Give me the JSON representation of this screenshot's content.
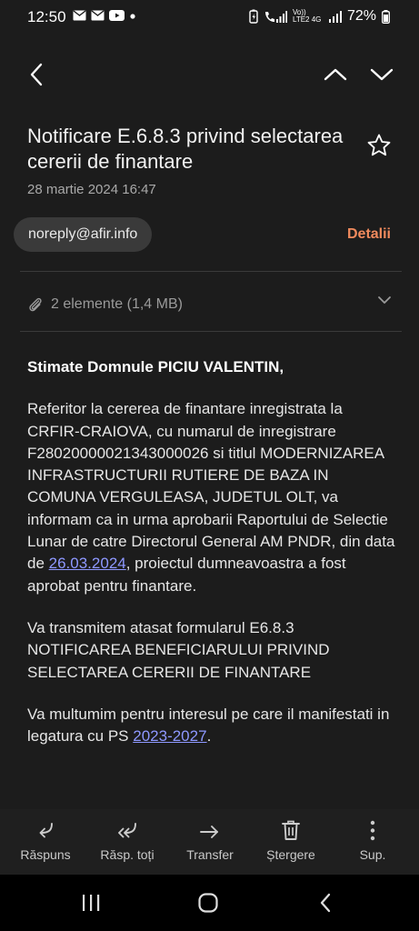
{
  "status_bar": {
    "time": "12:50",
    "battery": "72%",
    "network": "Vo)) LTE2 4G"
  },
  "email": {
    "subject": "Notificare E.6.8.3 privind selectarea cererii de finantare",
    "date": "28 martie 2024  16:47",
    "sender": "noreply@afir.info",
    "details_label": "Detalii",
    "attachments": "2 elemente (1,4 MB)",
    "greeting": "Stimate Domnule PICIU VALENTIN,",
    "para1_before": "Referitor la cererea de finantare inregistrata la CRFIR-CRAIOVA, cu numarul de inregistrare F28020000021343000026 si titlul MODERNIZAREA INFRASTRUCTURII RUTIERE DE BAZA IN COMUNA VERGULEASA, JUDETUL OLT, va informam ca in urma aprobarii Raportului de Selectie Lunar de catre Directorul General AM PNDR, din data de ",
    "para1_link": "26.03.2024",
    "para1_after": ", proiectul dumneavoastra a fost aprobat pentru finantare.",
    "para2": "Va transmitem atasat formularul E6.8.3 NOTIFICAREA BENEFICIARULUI PRIVIND SELECTAREA CERERII DE FINANTARE",
    "para3_before": "Va multumim pentru interesul pe care il manifestati in legatura cu PS ",
    "para3_link": "2023-2027",
    "para3_after": "."
  },
  "actions": [
    {
      "label": "Răspuns",
      "icon": "reply-icon"
    },
    {
      "label": "Răsp. toți",
      "icon": "reply-all-icon"
    },
    {
      "label": "Transfer",
      "icon": "forward-icon"
    },
    {
      "label": "Ștergere",
      "icon": "trash-icon"
    },
    {
      "label": "Sup.",
      "icon": "more-icon"
    }
  ],
  "colors": {
    "background": "#1c1c1c",
    "accent": "#f08a5d",
    "link": "#8e98ff"
  }
}
